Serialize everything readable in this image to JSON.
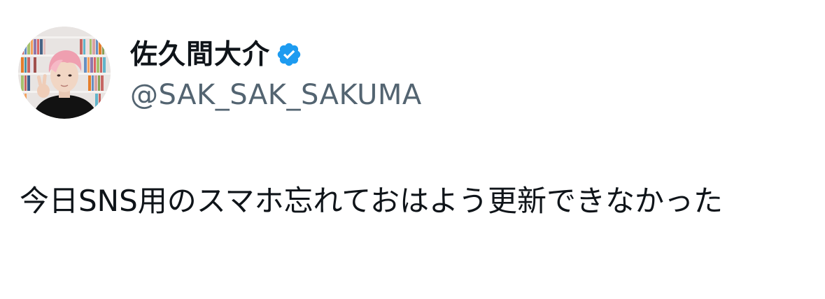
{
  "author": {
    "display_name": "佐久間大介",
    "handle": "@SAK_SAK_SAKUMA",
    "verified": true,
    "verified_badge_color": "#1d9bf0",
    "avatar_icon": "profile-photo"
  },
  "tweet": {
    "text": "今日SNS用のスマホ忘れておはよう更新できなかった"
  },
  "colors": {
    "text_primary": "#0f1419",
    "text_secondary": "#536471",
    "background": "#ffffff"
  }
}
